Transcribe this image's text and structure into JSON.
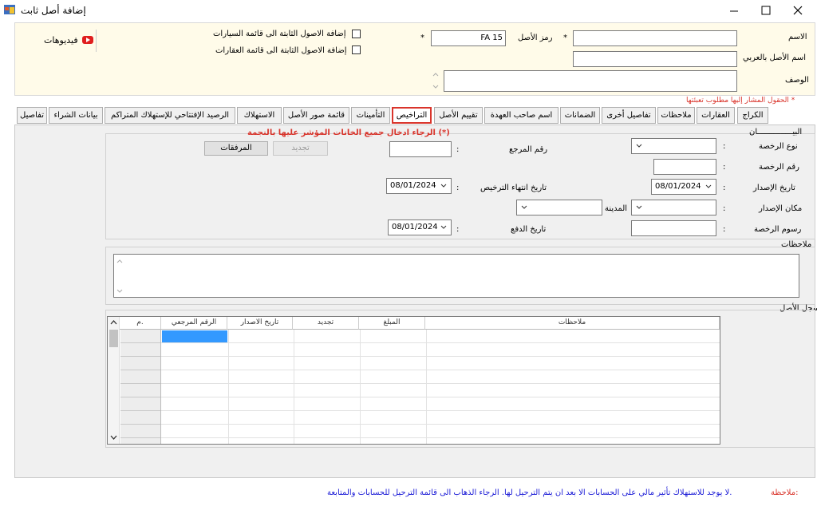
{
  "window": {
    "title": "إضافة أصل ثابت",
    "controls": [
      "minimize",
      "maximize",
      "close"
    ]
  },
  "header": {
    "name_label": "الاسم",
    "arabic_name_label": "اسم الأصل بالعربي",
    "description_label": "الوصف",
    "asset_code_label": "رمز الأصل",
    "asset_code_value": "FA 15",
    "required_star": "*",
    "add_to_cars_label": "إضافة الاصول الثابتة الى قائمة السيارات",
    "add_to_realestate_label": "إضافة الاصول الثابتة الى قائمة العقارات",
    "videos_label": "فيديوهات"
  },
  "required_note": "الحقول المشار إليها مطلوب تعبئتها *",
  "tabs": [
    {
      "label": "الكراج"
    },
    {
      "label": "العقارات"
    },
    {
      "label": "ملاحظات"
    },
    {
      "label": "تفاصيل أخرى"
    },
    {
      "label": "الضمانات"
    },
    {
      "label": "اسم صاحب العهدة"
    },
    {
      "label": "تقييم الأصل"
    },
    {
      "label": "التراخيص"
    },
    {
      "label": "التأمينات"
    },
    {
      "label": "قائمة صور الأصل"
    },
    {
      "label": "الاستهلاك"
    },
    {
      "label": "الرصيد الإفتتاحي للإستهلاك المتراكم"
    },
    {
      "label": "بيانات الشراء"
    },
    {
      "label": "تفاصيل"
    }
  ],
  "license": {
    "section_title": "البيـــــــــــــــان",
    "required_hint": "الرجاء ادخال جميع الخانات المؤشر عليها بالنجمة (*)",
    "license_type_label": "نوع الرخصة",
    "license_number_label": "رقم الرخصة",
    "issue_date_label": "تاريخ الإصدار",
    "issue_date_value": "08/01/2024",
    "issue_place_label": "مكان الإصدار",
    "city_label": "المدينة",
    "license_fees_label": "رسوم الرخصة",
    "reference_number_label": "رقم المرجع",
    "license_expiry_label": "تاريخ انتهاء الترخيص",
    "license_expiry_value": "08/01/2024",
    "payment_date_label": "تاريخ الدفع",
    "payment_date_value": "08/01/2024",
    "renew_button": "تجديد",
    "attachments_button": "المرفقات",
    "colon": ":"
  },
  "notes_label": "ملاحظات",
  "asset_log": {
    "label": "سجل الأصل",
    "columns": [
      "م.",
      "الرقم المرجعي",
      "تاريخ الاصدار",
      "تجديد",
      "المبلغ",
      "ملاحظات"
    ]
  },
  "footer": {
    "note_label": "ملاحظة:",
    "note_text": "لا يوجد للاستهلاك تأثير مالي على الحسابات الا بعد ان يتم الترحيل لها. الرجاء الذهاب الى قائمة الترحيل للحسابات والمتابعة."
  },
  "colors": {
    "header_bg": "#fffbe9",
    "required_red": "#d9342b",
    "footer_blue": "#1a1ad6",
    "tab_active_border": "#d9342b"
  }
}
